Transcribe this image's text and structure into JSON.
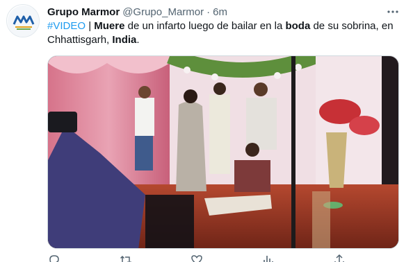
{
  "author": {
    "display_name": "Grupo Marmor",
    "handle": "@Grupo_Marmor",
    "separator": "·",
    "time": "6m",
    "avatar_initials": "M"
  },
  "tweet": {
    "hashtag": "#VIDEO",
    "pipe": " | ",
    "bold_1": "Muere",
    "text_1": " de un infarto luego de bailar en la ",
    "bold_2": "boda",
    "text_2": " de su sobrina, en Chhattisgarh, ",
    "bold_3": "India",
    "text_3": "."
  },
  "icons": {
    "more": "more-icon",
    "reply": "reply-icon",
    "retweet": "retweet-icon",
    "like": "like-icon",
    "views": "views-icon",
    "share": "share-icon"
  },
  "colors": {
    "accent": "#1d9bf0",
    "text": "#0f1419",
    "muted": "#536471"
  }
}
